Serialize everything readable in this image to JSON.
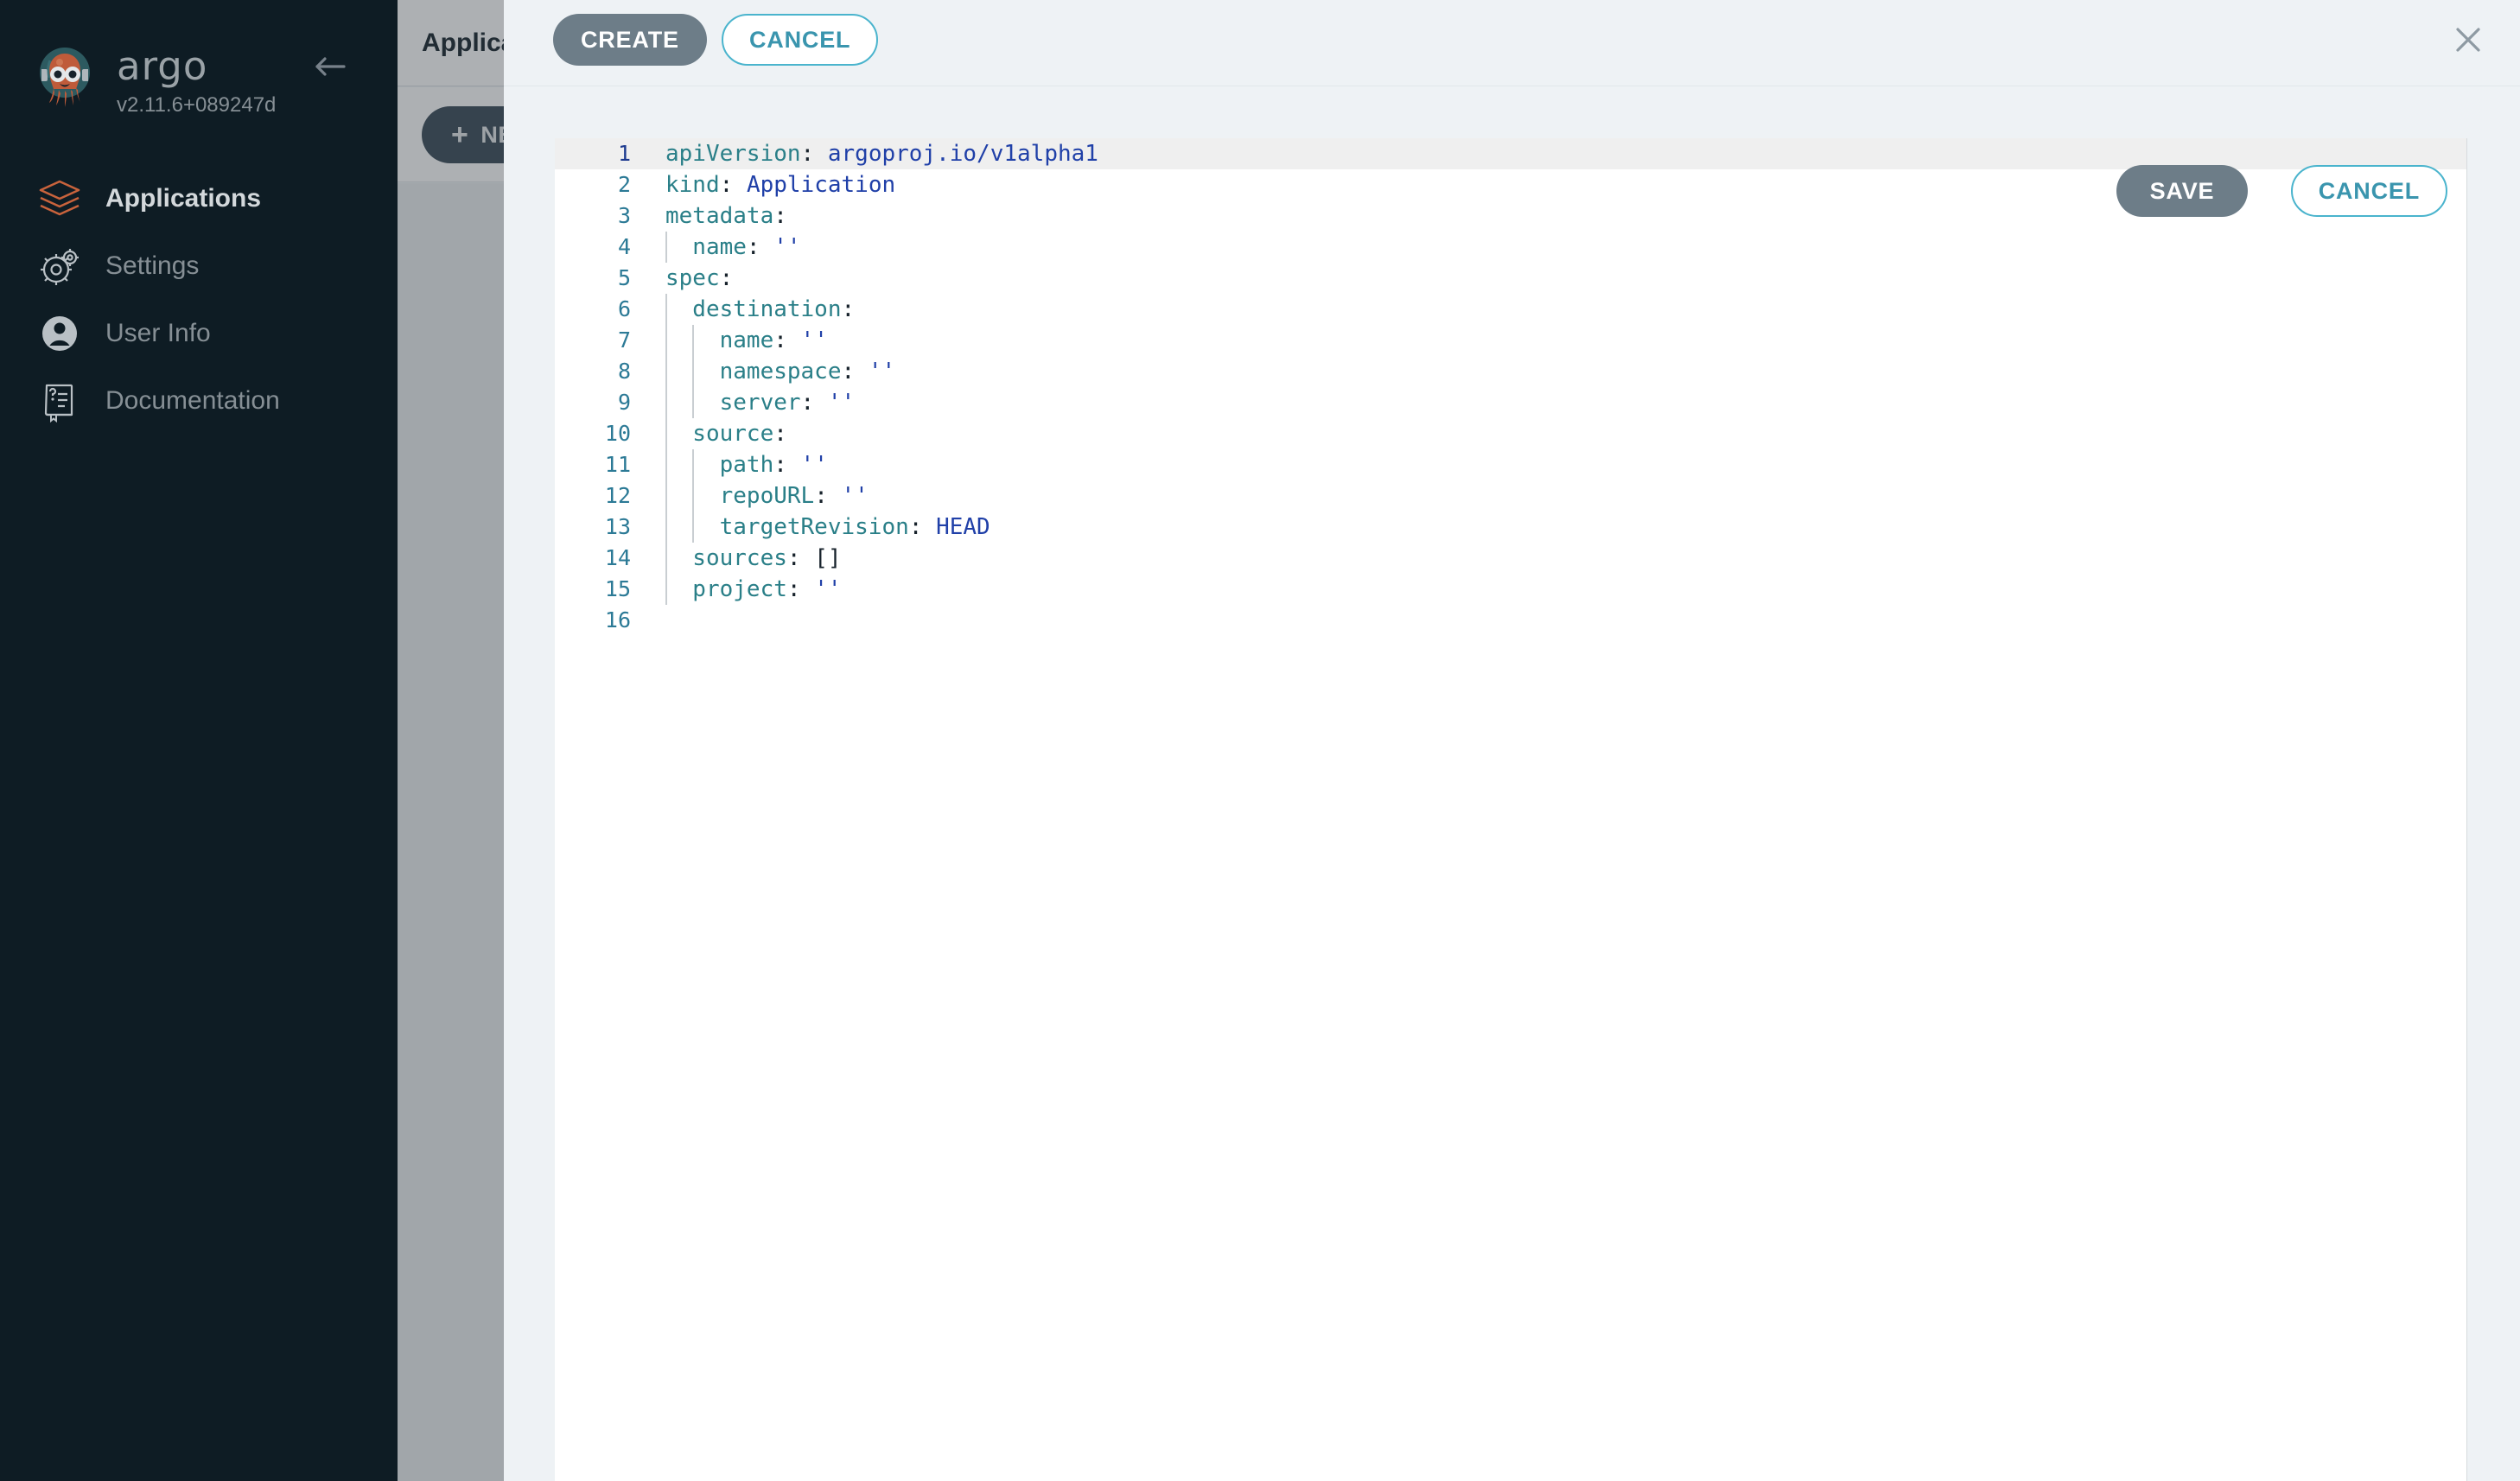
{
  "sidebar": {
    "brand": {
      "wordmark": "argo",
      "version": "v2.11.6+089247d",
      "logo_icon": "argo-octopus-logo",
      "collapse_icon": "arrow-left-icon"
    },
    "items": [
      {
        "label": "Applications",
        "icon": "layers-icon",
        "active": true
      },
      {
        "label": "Settings",
        "icon": "gear-icon",
        "active": false
      },
      {
        "label": "User Info",
        "icon": "user-circle-icon",
        "active": false
      },
      {
        "label": "Documentation",
        "icon": "book-question-icon",
        "active": false
      }
    ]
  },
  "background_page": {
    "title": "Applications",
    "new_app_button": "NEW APP",
    "new_app_icon": "plus-icon"
  },
  "modal": {
    "create_label": "CREATE",
    "cancel_label": "CANCEL",
    "close_icon": "close-x-icon"
  },
  "editor": {
    "save_label": "SAVE",
    "cancel_label": "CANCEL",
    "language": "yaml",
    "active_line": 1,
    "lines": [
      {
        "n": "1",
        "guides": [],
        "tokens": [
          {
            "t": "apiVersion",
            "c": "key"
          },
          {
            "t": ":",
            "c": "punct"
          },
          {
            "t": " ",
            "c": "plain"
          },
          {
            "t": "argoproj.io/v1alpha1",
            "c": "val"
          }
        ]
      },
      {
        "n": "2",
        "guides": [],
        "tokens": [
          {
            "t": "kind",
            "c": "key"
          },
          {
            "t": ":",
            "c": "punct"
          },
          {
            "t": " ",
            "c": "plain"
          },
          {
            "t": "Application",
            "c": "val"
          }
        ]
      },
      {
        "n": "3",
        "guides": [],
        "tokens": [
          {
            "t": "metadata",
            "c": "key"
          },
          {
            "t": ":",
            "c": "punct"
          }
        ]
      },
      {
        "n": "4",
        "guides": [
          0
        ],
        "tokens": [
          {
            "t": "  name",
            "c": "key"
          },
          {
            "t": ":",
            "c": "punct"
          },
          {
            "t": " ",
            "c": "plain"
          },
          {
            "t": "''",
            "c": "val"
          }
        ]
      },
      {
        "n": "5",
        "guides": [],
        "tokens": [
          {
            "t": "spec",
            "c": "key"
          },
          {
            "t": ":",
            "c": "punct"
          }
        ]
      },
      {
        "n": "6",
        "guides": [
          0
        ],
        "tokens": [
          {
            "t": "  destination",
            "c": "key"
          },
          {
            "t": ":",
            "c": "punct"
          }
        ]
      },
      {
        "n": "7",
        "guides": [
          0,
          1
        ],
        "tokens": [
          {
            "t": "    name",
            "c": "key"
          },
          {
            "t": ":",
            "c": "punct"
          },
          {
            "t": " ",
            "c": "plain"
          },
          {
            "t": "''",
            "c": "val"
          }
        ]
      },
      {
        "n": "8",
        "guides": [
          0,
          1
        ],
        "tokens": [
          {
            "t": "    namespace",
            "c": "key"
          },
          {
            "t": ":",
            "c": "punct"
          },
          {
            "t": " ",
            "c": "plain"
          },
          {
            "t": "''",
            "c": "val"
          }
        ]
      },
      {
        "n": "9",
        "guides": [
          0,
          1
        ],
        "tokens": [
          {
            "t": "    server",
            "c": "key"
          },
          {
            "t": ":",
            "c": "punct"
          },
          {
            "t": " ",
            "c": "plain"
          },
          {
            "t": "''",
            "c": "val"
          }
        ]
      },
      {
        "n": "10",
        "guides": [
          0
        ],
        "tokens": [
          {
            "t": "  source",
            "c": "key"
          },
          {
            "t": ":",
            "c": "punct"
          }
        ]
      },
      {
        "n": "11",
        "guides": [
          0,
          1
        ],
        "tokens": [
          {
            "t": "    path",
            "c": "key"
          },
          {
            "t": ":",
            "c": "punct"
          },
          {
            "t": " ",
            "c": "plain"
          },
          {
            "t": "''",
            "c": "val"
          }
        ]
      },
      {
        "n": "12",
        "guides": [
          0,
          1
        ],
        "tokens": [
          {
            "t": "    repoURL",
            "c": "key"
          },
          {
            "t": ":",
            "c": "punct"
          },
          {
            "t": " ",
            "c": "plain"
          },
          {
            "t": "''",
            "c": "val"
          }
        ]
      },
      {
        "n": "13",
        "guides": [
          0,
          1
        ],
        "tokens": [
          {
            "t": "    targetRevision",
            "c": "key"
          },
          {
            "t": ":",
            "c": "punct"
          },
          {
            "t": " ",
            "c": "plain"
          },
          {
            "t": "HEAD",
            "c": "val"
          }
        ]
      },
      {
        "n": "14",
        "guides": [
          0
        ],
        "tokens": [
          {
            "t": "  sources",
            "c": "key"
          },
          {
            "t": ":",
            "c": "punct"
          },
          {
            "t": " ",
            "c": "plain"
          },
          {
            "t": "[]",
            "c": "plain"
          }
        ]
      },
      {
        "n": "15",
        "guides": [
          0
        ],
        "tokens": [
          {
            "t": "  project",
            "c": "key"
          },
          {
            "t": ":",
            "c": "punct"
          },
          {
            "t": " ",
            "c": "plain"
          },
          {
            "t": "''",
            "c": "val"
          }
        ]
      },
      {
        "n": "16",
        "guides": [],
        "tokens": []
      }
    ]
  },
  "colors": {
    "sidebar_bg": "#0e1c24",
    "modal_bg": "#eef2f5",
    "accent_teal": "#4ab4cd",
    "accent_orange": "#c9633c",
    "button_solid": "#6d7d88"
  }
}
